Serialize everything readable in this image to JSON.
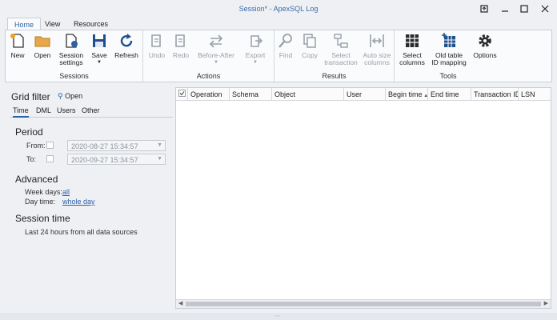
{
  "window": {
    "title": "Session* - ApexSQL Log"
  },
  "tabs": [
    {
      "label": "Home",
      "active": true
    },
    {
      "label": "View",
      "active": false
    },
    {
      "label": "Resources",
      "active": false
    }
  ],
  "ribbon": {
    "groups": [
      {
        "label": "Sessions",
        "buttons": [
          {
            "label": "New",
            "icon": "new-session-icon",
            "enabled": true
          },
          {
            "label": "Open",
            "icon": "folder-open-icon",
            "enabled": true
          },
          {
            "label": "Session\nsettings",
            "icon": "session-settings-icon",
            "enabled": true
          },
          {
            "label": "Save",
            "icon": "floppy-disk-icon",
            "enabled": true,
            "dropdown": true
          },
          {
            "label": "Refresh",
            "icon": "refresh-icon",
            "enabled": true
          }
        ]
      },
      {
        "label": "Actions",
        "buttons": [
          {
            "label": "Undo",
            "icon": "undo-script-icon",
            "enabled": false
          },
          {
            "label": "Redo",
            "icon": "redo-script-icon",
            "enabled": false
          },
          {
            "label": "Before-After",
            "icon": "before-after-icon",
            "enabled": false,
            "dropdown": true
          },
          {
            "label": "Export",
            "icon": "export-icon",
            "enabled": false,
            "dropdown": true
          }
        ]
      },
      {
        "label": "Results",
        "buttons": [
          {
            "label": "Find",
            "icon": "magnifier-icon",
            "enabled": false
          },
          {
            "label": "Copy",
            "icon": "copy-icon",
            "enabled": false
          },
          {
            "label": "Select\ntransaction",
            "icon": "select-transaction-icon",
            "enabled": false
          },
          {
            "label": "Auto size\ncolumns",
            "icon": "auto-size-columns-icon",
            "enabled": false
          }
        ]
      },
      {
        "label": "Tools",
        "buttons": [
          {
            "label": "Select\ncolumns",
            "icon": "select-columns-icon",
            "enabled": true
          },
          {
            "label": "Old table\nID mapping",
            "icon": "table-mapping-icon",
            "enabled": true
          },
          {
            "label": "Options",
            "icon": "gear-icon",
            "enabled": true
          }
        ]
      }
    ]
  },
  "filter": {
    "title": "Grid filter",
    "open_label": "Open",
    "subtabs": [
      "Time",
      "DML",
      "Users",
      "Other"
    ],
    "active_subtab": "Time",
    "period": {
      "heading": "Period",
      "from_label": "From:",
      "from_value": "2020-08-27 15:34:57",
      "to_label": "To:",
      "to_value": "2020-09-27 15:34:57"
    },
    "advanced": {
      "heading": "Advanced",
      "weekdays_label": "Week days:",
      "weekdays_value": "all",
      "daytime_label": "Day time:",
      "daytime_value": "whole day"
    },
    "session_time": {
      "heading": "Session time",
      "text": "Last 24 hours from all data sources"
    }
  },
  "grid": {
    "columns": [
      "Operation",
      "Schema",
      "Object",
      "User",
      "Begin time",
      "End time",
      "Transaction ID",
      "LSN"
    ],
    "sorted_column": "Begin time",
    "rows": []
  },
  "colors": {
    "accent": "#2a62a8",
    "title": "#3c6aa8",
    "disabled": "#9aa0a8"
  }
}
